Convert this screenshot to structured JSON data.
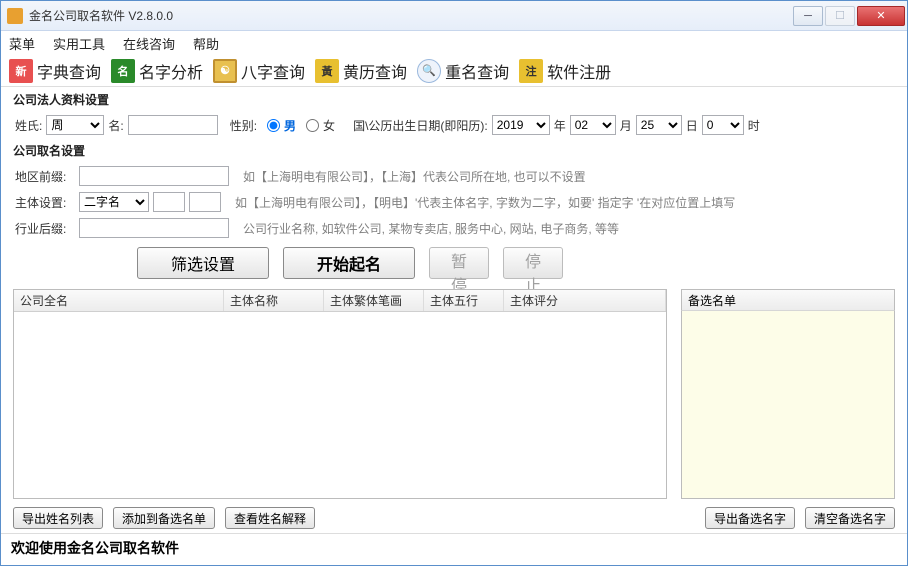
{
  "window": {
    "title": "金名公司取名软件 V2.8.0.0"
  },
  "menu": {
    "items": [
      "菜单",
      "实用工具",
      "在线咨询",
      "帮助"
    ]
  },
  "toolbar": {
    "dict": "字典查询",
    "name": "名字分析",
    "bazi": "八字查询",
    "huangli": "黄历查询",
    "repeat": "重名查询",
    "register": "软件注册"
  },
  "legal": {
    "group": "公司法人资料设置",
    "surname_label": "姓氏:",
    "surname": "周",
    "givenname_label": "名:",
    "gender_label": "性别:",
    "male": "男",
    "female": "女",
    "birth_label": "国\\公历出生日期(即阳历):",
    "year": "2019",
    "year_unit": "年",
    "month": "02",
    "month_unit": "月",
    "day": "25",
    "day_unit": "日",
    "hour": "0",
    "hour_unit": "时"
  },
  "naming": {
    "group": "公司取名设置",
    "prefix_label": "地区前缀:",
    "prefix_hint": "如【上海明电有限公司】，【上海】代表公司所在地, 也可以不设置",
    "body_label": "主体设置:",
    "body_value": "二字名",
    "body_hint": "如【上海明电有限公司】，【明电】'代表主体名字, 字数为二字，如要' 指定字 '在对应位置上填写",
    "suffix_label": "行业后缀:",
    "suffix_hint": "公司行业名称, 如软件公司, 某物专卖店, 服务中心, 网站, 电子商务, 等等"
  },
  "actions": {
    "filter": "筛选设置",
    "start": "开始起名",
    "pause": "暂停",
    "stop": "停止"
  },
  "table": {
    "cols": [
      "公司全名",
      "主体名称",
      "主体繁体笔画",
      "主体五行",
      "主体评分"
    ]
  },
  "side": {
    "title": "备选名单"
  },
  "bottom": {
    "export_list": "导出姓名列表",
    "add_cand": "添加到备选名单",
    "view_meaning": "查看姓名解释",
    "export_cand": "导出备选名字",
    "clear_cand": "清空备选名字"
  },
  "status": "欢迎使用金名公司取名软件"
}
